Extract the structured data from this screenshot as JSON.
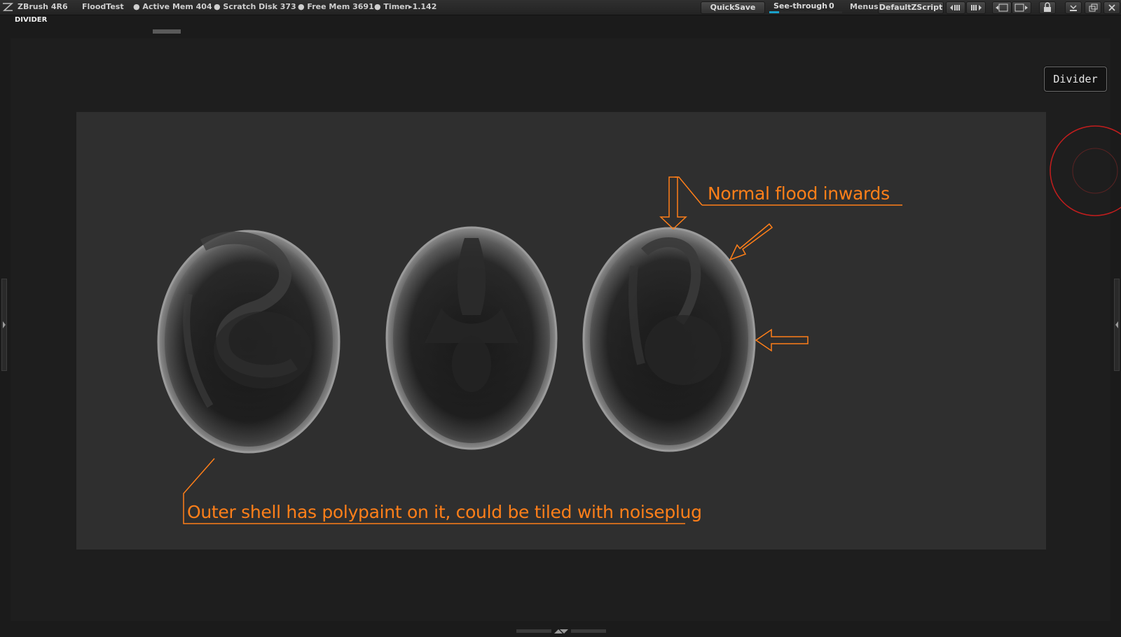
{
  "topbar": {
    "app_name": "ZBrush 4R6",
    "doc_name": "FloodTest",
    "active_mem": "● Active Mem 404",
    "scratch_disk": "● Scratch Disk 373",
    "free_mem": "● Free Mem 3691",
    "timer": "● Timer▸1.142",
    "quicksave_label": "QuickSave",
    "seethrough_label": "See-through",
    "seethrough_value": "0",
    "menus_label": "Menus",
    "script_label": "DefaultZScript"
  },
  "palette": {
    "title": "DIVIDER"
  },
  "canvas": {
    "divider_button_label": "Divider",
    "annotation_top": "Normal flood inwards",
    "annotation_bottom": "Outer shell has polypaint on it, could be tiled with noiseplug"
  },
  "colors": {
    "annotation": "#ff7f19",
    "accent": "#1aa0c8",
    "canvas_bg": "#2f2f2f"
  }
}
